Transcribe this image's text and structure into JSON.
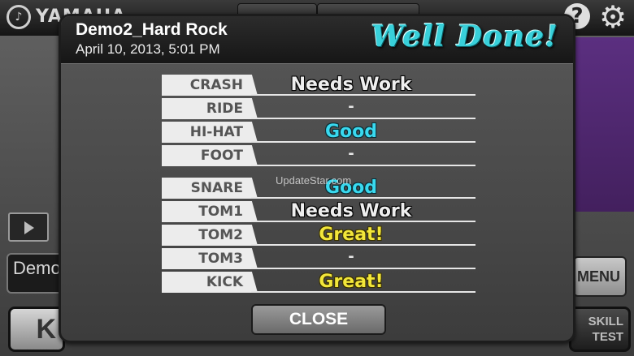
{
  "app": {
    "brand": "YAMAHA",
    "help_icon": "question-mark-icon",
    "settings_icon": "gear-icon",
    "song_field_text": "Demo",
    "menu_label": "MENU",
    "left_button_label": "K",
    "skill_test_line1": "SKILL",
    "skill_test_line2": "TEST"
  },
  "modal": {
    "song_title": "Demo2_Hard Rock",
    "date": "April 10, 2013, 5:01 PM",
    "result_banner": "Well Done!",
    "watermark": "UpdateStar.com",
    "close_label": "CLOSE",
    "group1": [
      {
        "label": "CRASH",
        "value": "Needs Work",
        "grade": "needs-work"
      },
      {
        "label": "RIDE",
        "value": "-",
        "grade": "none"
      },
      {
        "label": "HI-HAT",
        "value": "Good",
        "grade": "good"
      },
      {
        "label": "FOOT",
        "value": "-",
        "grade": "none"
      }
    ],
    "group2": [
      {
        "label": "SNARE",
        "value": "Good",
        "grade": "good"
      },
      {
        "label": "TOM1",
        "value": "Needs Work",
        "grade": "needs-work"
      },
      {
        "label": "TOM2",
        "value": "Great!",
        "grade": "great"
      },
      {
        "label": "TOM3",
        "value": "-",
        "grade": "none"
      },
      {
        "label": "KICK",
        "value": "Great!",
        "grade": "great"
      }
    ]
  },
  "colors": {
    "well_done": "#38d0da",
    "good": "#39d9ef",
    "great": "#f2e63a",
    "needs_work": "#eeeeee"
  }
}
